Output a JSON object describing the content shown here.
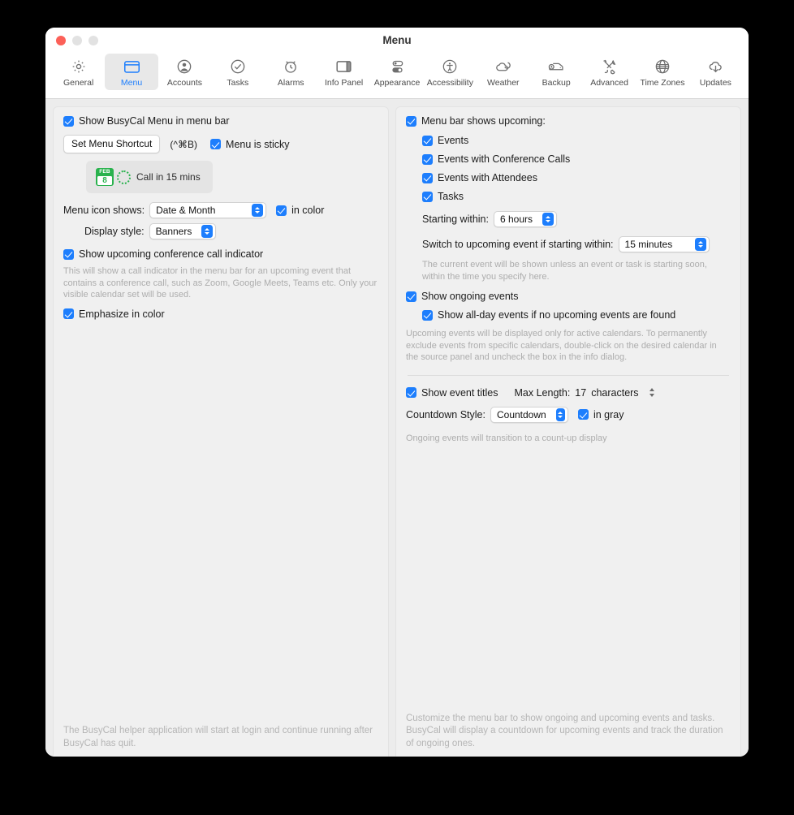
{
  "window": {
    "title": "Menu",
    "traffic": {
      "close": "close-button",
      "minimize": "minimize-button",
      "zoom": "zoom-button"
    }
  },
  "toolbar": {
    "selected": "Menu",
    "items": [
      {
        "label": "General",
        "icon": "gear-icon"
      },
      {
        "label": "Menu",
        "icon": "menubar-window-icon"
      },
      {
        "label": "Accounts",
        "icon": "account-person-icon"
      },
      {
        "label": "Tasks",
        "icon": "checkmark-circle-icon"
      },
      {
        "label": "Alarms",
        "icon": "alarm-clock-icon"
      },
      {
        "label": "Info Panel",
        "icon": "side-panel-icon"
      },
      {
        "label": "Appearance",
        "icon": "toggles-icon"
      },
      {
        "label": "Accessibility",
        "icon": "accessibility-icon"
      },
      {
        "label": "Weather",
        "icon": "cloud-moon-icon"
      },
      {
        "label": "Backup",
        "icon": "backup-disk-icon"
      },
      {
        "label": "Advanced",
        "icon": "tools-cross-icon"
      },
      {
        "label": "Time Zones",
        "icon": "globe-icon"
      },
      {
        "label": "Updates",
        "icon": "cloud-download-icon"
      }
    ]
  },
  "left_panel": {
    "show_menu_checkbox": "Show BusyCal Menu in menu bar",
    "set_shortcut_button": "Set Menu Shortcut",
    "shortcut_value": "(^⌘B)",
    "menu_sticky_checkbox": "Menu is sticky",
    "preview": {
      "cal_month": "FEB",
      "cal_day": "8",
      "text": "Call in 15 mins"
    },
    "menu_icon_label": "Menu icon shows:",
    "menu_icon_value": "Date & Month",
    "in_color_checkbox": "in color",
    "display_style_label": "Display style:",
    "display_style_value": "Banners",
    "conference_indicator_checkbox": "Show upcoming conference call indicator",
    "conference_help": "This will show a call indicator in the menu bar for an upcoming event that contains a conference call, such as Zoom, Google Meets, Teams etc. Only your visible calendar set will be used.",
    "emphasize_checkbox": "Emphasize in color",
    "footer": "The BusyCal helper application will start at login and continue running after BusyCal has quit."
  },
  "right_panel": {
    "menu_bar_shows_checkbox": "Menu bar shows upcoming:",
    "sub_checkboxes": [
      "Events",
      "Events with Conference Calls",
      "Events with Attendees",
      "Tasks"
    ],
    "starting_within_label": "Starting within:",
    "starting_within_value": "6 hours",
    "switch_label": "Switch to upcoming event if starting within:",
    "switch_value": "15 minutes",
    "switch_help": "The current event will be shown unless an event or task is starting soon, within the time you specify here.",
    "ongoing_checkbox": "Show ongoing events",
    "allday_checkbox": "Show all-day events if no upcoming events are found",
    "calendars_help": "Upcoming events will be displayed only for active calendars. To permanently exclude events from specific calendars, double-click on the desired calendar in the source panel and uncheck the box in the info dialog.",
    "show_titles_checkbox": "Show event titles",
    "max_length_label": "Max Length:",
    "max_length_value": "17",
    "max_length_unit": "characters",
    "countdown_style_label": "Countdown Style:",
    "countdown_style_value": "Countdown",
    "in_gray_checkbox": "in gray",
    "countdown_help": "Ongoing events will transition to a count-up display",
    "footer": "Customize the menu bar to show ongoing and upcoming events and tasks. BusyCal will display a countdown for upcoming events and track the duration of ongoing ones."
  },
  "colors": {
    "accent": "#1d7efd",
    "calendar_green": "#29b24d",
    "close_red": "#fc6058"
  }
}
